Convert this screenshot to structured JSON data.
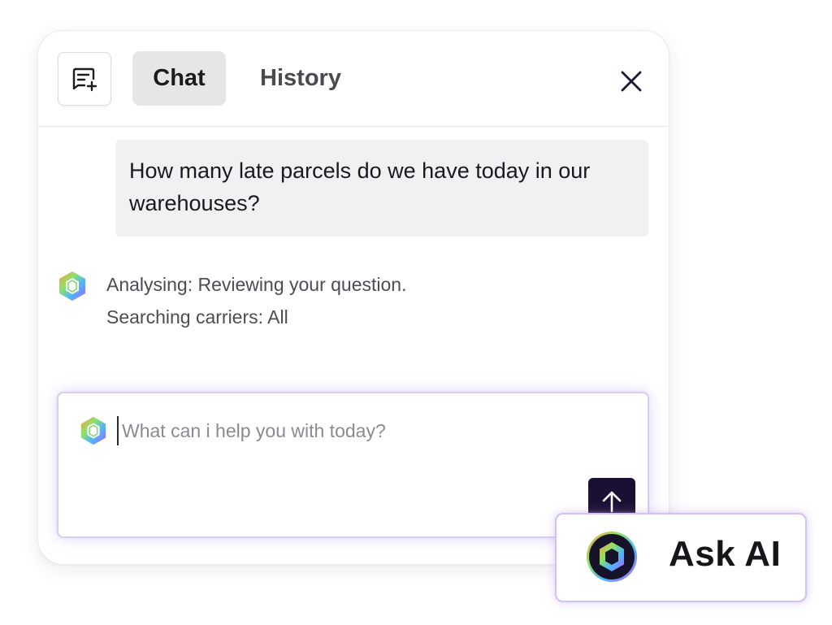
{
  "header": {
    "new_chat_icon": "new-chat-icon",
    "tabs": [
      {
        "label": "Chat",
        "active": true
      },
      {
        "label": "History",
        "active": false
      }
    ],
    "close_icon": "close-icon"
  },
  "conversation": {
    "user_message": "How many late parcels do we have today in our warehouses?",
    "ai_status_lines": [
      "Analysing: Reviewing your question.",
      "Searching carriers: All"
    ]
  },
  "composer": {
    "input_value": "",
    "placeholder": "What can i help you with today?",
    "send_icon": "arrow-up-icon"
  },
  "ask_ai": {
    "label": "Ask AI"
  },
  "colors": {
    "send_button": "#1a1033",
    "active_tab_bg": "#e6e6e8",
    "user_bubble_bg": "#f1f1f3"
  }
}
